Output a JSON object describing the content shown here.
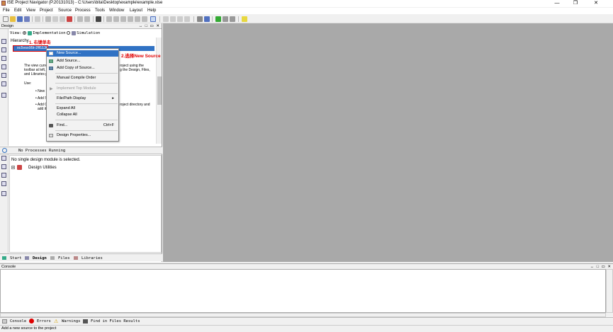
{
  "titlebar": {
    "title": "ISE Project Navigator (P.20131013) - C:\\Users\\bita\\Desktop\\example\\example.xise",
    "minimize": "—",
    "maximize": "❐",
    "close": "✕"
  },
  "menus": [
    "File",
    "Edit",
    "View",
    "Project",
    "Source",
    "Process",
    "Tools",
    "Window",
    "Layout",
    "Help"
  ],
  "design_panel": {
    "header": "Design",
    "controls": "↔ □ ▭ ✕",
    "view_label": "View:",
    "view_impl": "Implementation",
    "view_sim": "Simulation",
    "hierarchy_label": "Hierarchy",
    "annotation1": "1. 右键单击",
    "device": "xc5vsx95t-2ff1136",
    "help_text_1": "The view curre",
    "help_text_1b": "roject using the",
    "help_text_2": "toolbar at left,",
    "help_text_2b": "g the Design, Files,",
    "help_text_3": "and Libraries p",
    "use_label": "Use:",
    "bullet1": "• New So",
    "bullet2": "• Add So",
    "bullet3": "• Add Co",
    "bullet3b": "roject directory and",
    "bullet4": "add it t"
  },
  "annotation2": "2.选择New Source",
  "context_menu": {
    "new_source": "New Source...",
    "add_source": "Add Source...",
    "add_copy": "Add Copy of Source...",
    "manual_compile": "Manual Compile Order",
    "implement_top": "Implement Top Module",
    "file_path": "File/Path Display",
    "submenu_arrow": "▸",
    "expand_all": "Expand All",
    "collapse_all": "Collapse All",
    "find": "Find...",
    "find_shortcut": "Ctrl+F",
    "design_props": "Design Properties..."
  },
  "processes": {
    "header": "No Processes Running",
    "no_module": "No single design module is selected.",
    "design_utilities": "Design Utilities"
  },
  "left_tabs": [
    "Start",
    "Design",
    "Files",
    "Libraries"
  ],
  "console": {
    "header": "Console",
    "controls": "↔ □ ▭ ✕",
    "tabs": [
      "Console",
      "Errors",
      "Warnings",
      "Find in Files Results"
    ]
  },
  "status": "Add a new source to the project",
  "colors": {
    "workspace": "#a9a9a9",
    "selection": "#3072c4",
    "annotation": "#e00000"
  }
}
